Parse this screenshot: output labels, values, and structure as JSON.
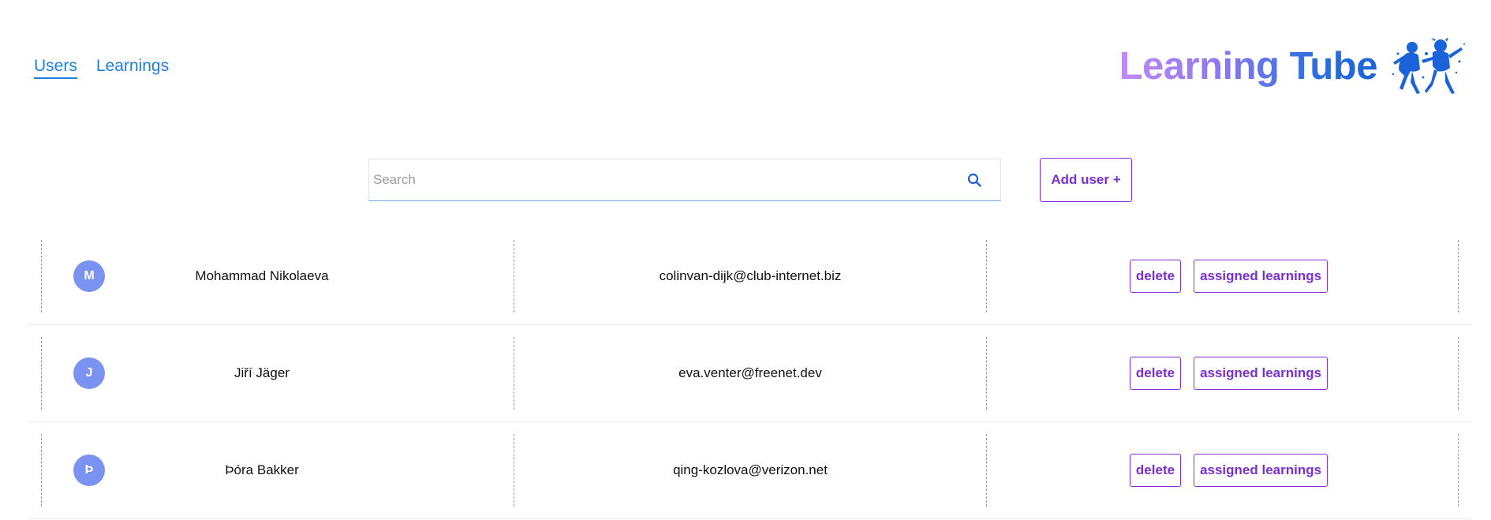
{
  "nav": {
    "items": [
      {
        "label": "Users",
        "active": true
      },
      {
        "label": "Learnings",
        "active": false
      }
    ]
  },
  "brand": {
    "title": "Learning Tube",
    "logo_icon": "dancing-figures-logo-icon"
  },
  "search": {
    "placeholder": "Search",
    "value": "",
    "icon": "search-icon"
  },
  "toolbar": {
    "add_user_label": "Add user +"
  },
  "users": [
    {
      "initial": "M",
      "name": "Mohammad Nikolaeva",
      "email": "colinvan-dijk@club-internet.biz",
      "delete_label": "delete",
      "learnings_label": "assigned learnings"
    },
    {
      "initial": "J",
      "name": "Jiří Jäger",
      "email": "eva.venter@freenet.dev",
      "delete_label": "delete",
      "learnings_label": "assigned learnings"
    },
    {
      "initial": "Þ",
      "name": "Þóra Bakker",
      "email": "qing-kozlova@verizon.net",
      "delete_label": "delete",
      "learnings_label": "assigned learnings"
    }
  ],
  "colors": {
    "link": "#1e7fdc",
    "accent_purple": "#8a2be2",
    "avatar_bg": "#7b93f0",
    "brand_gradient_start": "#c18af5",
    "brand_gradient_end": "#1a63d8"
  }
}
